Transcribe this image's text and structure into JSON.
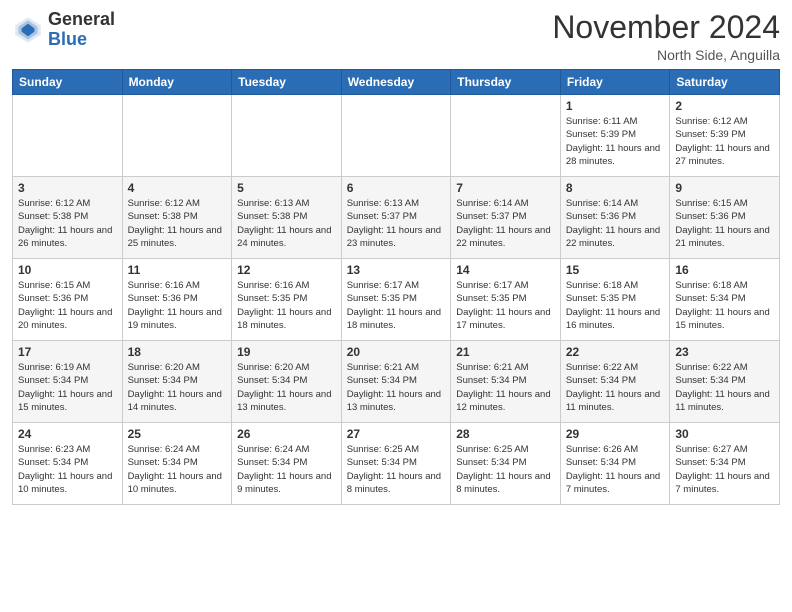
{
  "header": {
    "logo_line1": "General",
    "logo_line2": "Blue",
    "month_title": "November 2024",
    "location": "North Side, Anguilla"
  },
  "days_of_week": [
    "Sunday",
    "Monday",
    "Tuesday",
    "Wednesday",
    "Thursday",
    "Friday",
    "Saturday"
  ],
  "weeks": [
    [
      {
        "day": "",
        "sunrise": "",
        "sunset": "",
        "daylight": ""
      },
      {
        "day": "",
        "sunrise": "",
        "sunset": "",
        "daylight": ""
      },
      {
        "day": "",
        "sunrise": "",
        "sunset": "",
        "daylight": ""
      },
      {
        "day": "",
        "sunrise": "",
        "sunset": "",
        "daylight": ""
      },
      {
        "day": "",
        "sunrise": "",
        "sunset": "",
        "daylight": ""
      },
      {
        "day": "1",
        "sunrise": "Sunrise: 6:11 AM",
        "sunset": "Sunset: 5:39 PM",
        "daylight": "Daylight: 11 hours and 28 minutes."
      },
      {
        "day": "2",
        "sunrise": "Sunrise: 6:12 AM",
        "sunset": "Sunset: 5:39 PM",
        "daylight": "Daylight: 11 hours and 27 minutes."
      }
    ],
    [
      {
        "day": "3",
        "sunrise": "Sunrise: 6:12 AM",
        "sunset": "Sunset: 5:38 PM",
        "daylight": "Daylight: 11 hours and 26 minutes."
      },
      {
        "day": "4",
        "sunrise": "Sunrise: 6:12 AM",
        "sunset": "Sunset: 5:38 PM",
        "daylight": "Daylight: 11 hours and 25 minutes."
      },
      {
        "day": "5",
        "sunrise": "Sunrise: 6:13 AM",
        "sunset": "Sunset: 5:38 PM",
        "daylight": "Daylight: 11 hours and 24 minutes."
      },
      {
        "day": "6",
        "sunrise": "Sunrise: 6:13 AM",
        "sunset": "Sunset: 5:37 PM",
        "daylight": "Daylight: 11 hours and 23 minutes."
      },
      {
        "day": "7",
        "sunrise": "Sunrise: 6:14 AM",
        "sunset": "Sunset: 5:37 PM",
        "daylight": "Daylight: 11 hours and 22 minutes."
      },
      {
        "day": "8",
        "sunrise": "Sunrise: 6:14 AM",
        "sunset": "Sunset: 5:36 PM",
        "daylight": "Daylight: 11 hours and 22 minutes."
      },
      {
        "day": "9",
        "sunrise": "Sunrise: 6:15 AM",
        "sunset": "Sunset: 5:36 PM",
        "daylight": "Daylight: 11 hours and 21 minutes."
      }
    ],
    [
      {
        "day": "10",
        "sunrise": "Sunrise: 6:15 AM",
        "sunset": "Sunset: 5:36 PM",
        "daylight": "Daylight: 11 hours and 20 minutes."
      },
      {
        "day": "11",
        "sunrise": "Sunrise: 6:16 AM",
        "sunset": "Sunset: 5:36 PM",
        "daylight": "Daylight: 11 hours and 19 minutes."
      },
      {
        "day": "12",
        "sunrise": "Sunrise: 6:16 AM",
        "sunset": "Sunset: 5:35 PM",
        "daylight": "Daylight: 11 hours and 18 minutes."
      },
      {
        "day": "13",
        "sunrise": "Sunrise: 6:17 AM",
        "sunset": "Sunset: 5:35 PM",
        "daylight": "Daylight: 11 hours and 18 minutes."
      },
      {
        "day": "14",
        "sunrise": "Sunrise: 6:17 AM",
        "sunset": "Sunset: 5:35 PM",
        "daylight": "Daylight: 11 hours and 17 minutes."
      },
      {
        "day": "15",
        "sunrise": "Sunrise: 6:18 AM",
        "sunset": "Sunset: 5:35 PM",
        "daylight": "Daylight: 11 hours and 16 minutes."
      },
      {
        "day": "16",
        "sunrise": "Sunrise: 6:18 AM",
        "sunset": "Sunset: 5:34 PM",
        "daylight": "Daylight: 11 hours and 15 minutes."
      }
    ],
    [
      {
        "day": "17",
        "sunrise": "Sunrise: 6:19 AM",
        "sunset": "Sunset: 5:34 PM",
        "daylight": "Daylight: 11 hours and 15 minutes."
      },
      {
        "day": "18",
        "sunrise": "Sunrise: 6:20 AM",
        "sunset": "Sunset: 5:34 PM",
        "daylight": "Daylight: 11 hours and 14 minutes."
      },
      {
        "day": "19",
        "sunrise": "Sunrise: 6:20 AM",
        "sunset": "Sunset: 5:34 PM",
        "daylight": "Daylight: 11 hours and 13 minutes."
      },
      {
        "day": "20",
        "sunrise": "Sunrise: 6:21 AM",
        "sunset": "Sunset: 5:34 PM",
        "daylight": "Daylight: 11 hours and 13 minutes."
      },
      {
        "day": "21",
        "sunrise": "Sunrise: 6:21 AM",
        "sunset": "Sunset: 5:34 PM",
        "daylight": "Daylight: 11 hours and 12 minutes."
      },
      {
        "day": "22",
        "sunrise": "Sunrise: 6:22 AM",
        "sunset": "Sunset: 5:34 PM",
        "daylight": "Daylight: 11 hours and 11 minutes."
      },
      {
        "day": "23",
        "sunrise": "Sunrise: 6:22 AM",
        "sunset": "Sunset: 5:34 PM",
        "daylight": "Daylight: 11 hours and 11 minutes."
      }
    ],
    [
      {
        "day": "24",
        "sunrise": "Sunrise: 6:23 AM",
        "sunset": "Sunset: 5:34 PM",
        "daylight": "Daylight: 11 hours and 10 minutes."
      },
      {
        "day": "25",
        "sunrise": "Sunrise: 6:24 AM",
        "sunset": "Sunset: 5:34 PM",
        "daylight": "Daylight: 11 hours and 10 minutes."
      },
      {
        "day": "26",
        "sunrise": "Sunrise: 6:24 AM",
        "sunset": "Sunset: 5:34 PM",
        "daylight": "Daylight: 11 hours and 9 minutes."
      },
      {
        "day": "27",
        "sunrise": "Sunrise: 6:25 AM",
        "sunset": "Sunset: 5:34 PM",
        "daylight": "Daylight: 11 hours and 8 minutes."
      },
      {
        "day": "28",
        "sunrise": "Sunrise: 6:25 AM",
        "sunset": "Sunset: 5:34 PM",
        "daylight": "Daylight: 11 hours and 8 minutes."
      },
      {
        "day": "29",
        "sunrise": "Sunrise: 6:26 AM",
        "sunset": "Sunset: 5:34 PM",
        "daylight": "Daylight: 11 hours and 7 minutes."
      },
      {
        "day": "30",
        "sunrise": "Sunrise: 6:27 AM",
        "sunset": "Sunset: 5:34 PM",
        "daylight": "Daylight: 11 hours and 7 minutes."
      }
    ]
  ]
}
